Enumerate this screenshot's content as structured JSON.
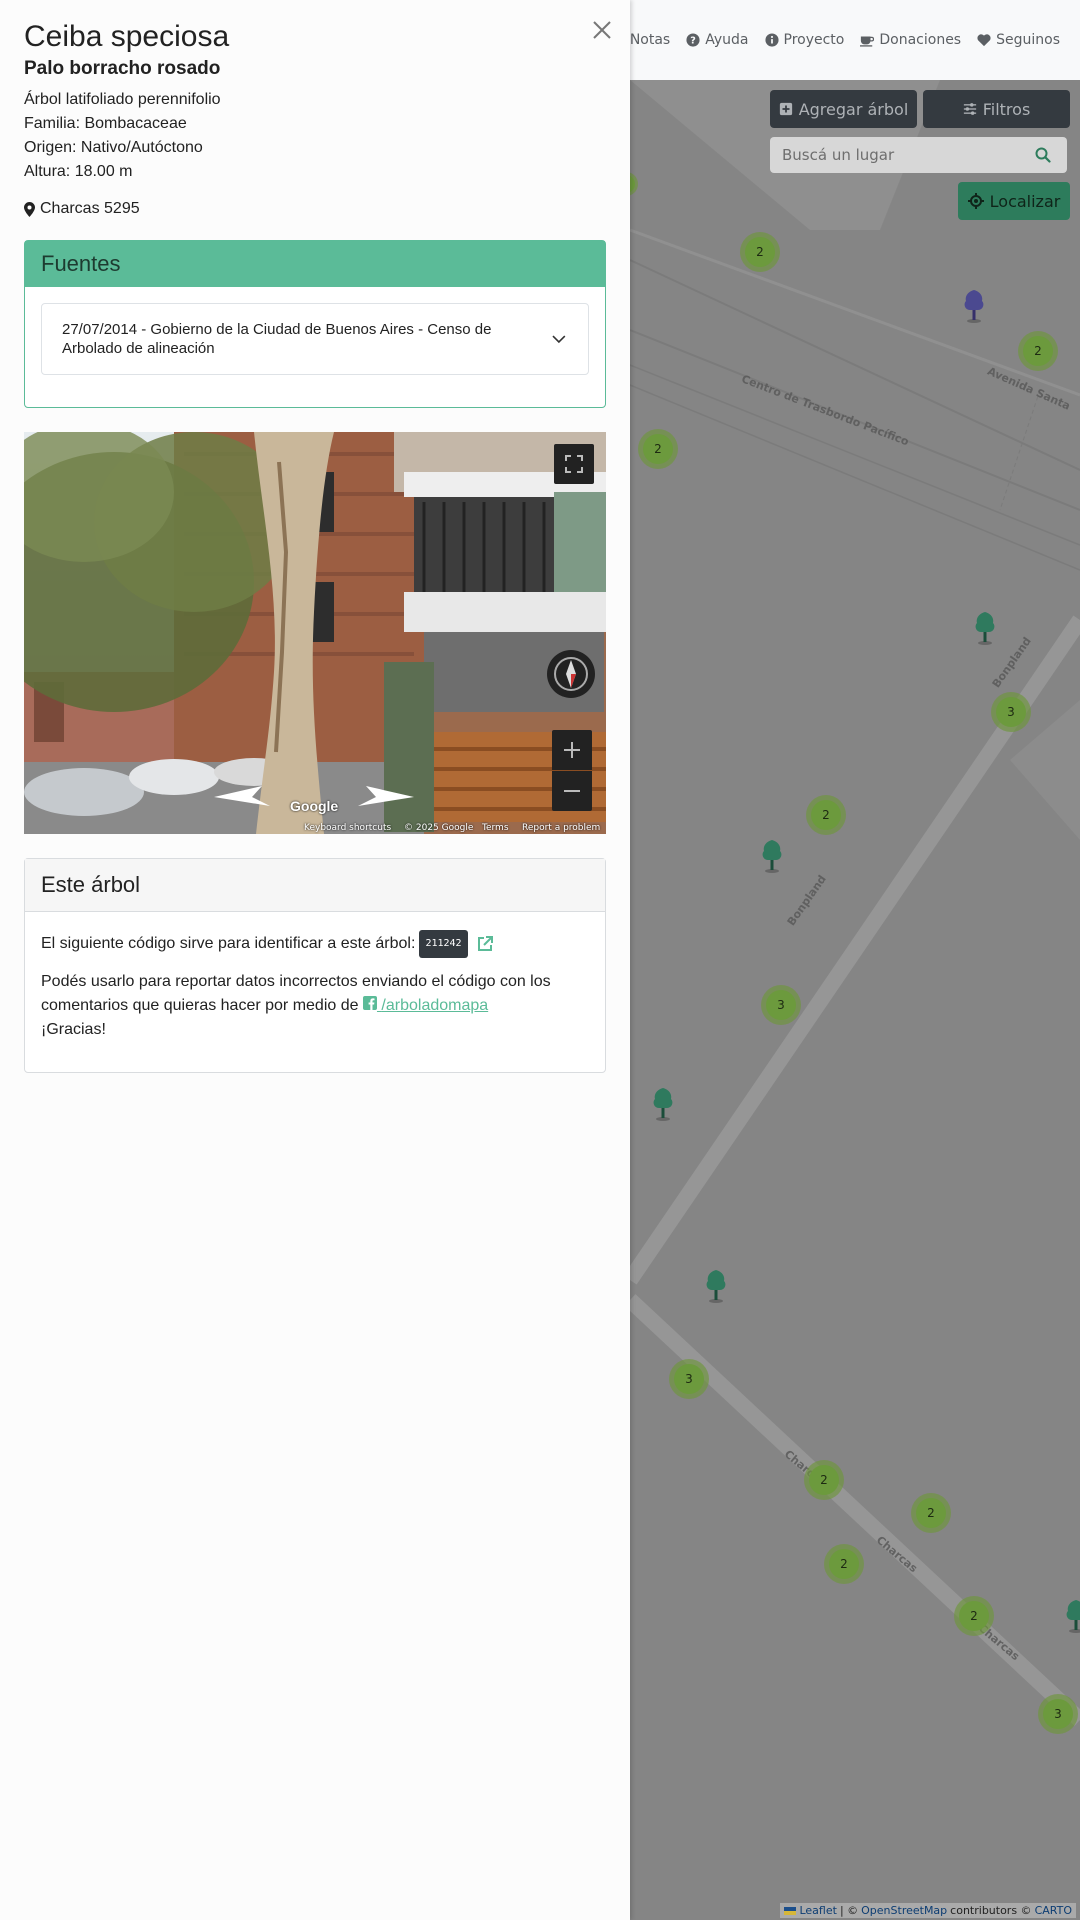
{
  "nav": {
    "items": [
      {
        "label": "Notas",
        "icon": "file-pen-icon"
      },
      {
        "label": "Ayuda",
        "icon": "question-circle-icon"
      },
      {
        "label": "Proyecto",
        "icon": "info-circle-icon"
      },
      {
        "label": "Donaciones",
        "icon": "coffee-cup-icon"
      },
      {
        "label": "Seguinos",
        "icon": "heart-icon"
      }
    ]
  },
  "map": {
    "add_tree_label": "Agregar árbol",
    "filters_label": "Filtros",
    "search_placeholder": "Buscá un lugar",
    "locate_label": "Localizar",
    "streets": [
      "Centro de Trasbordo Pacífico",
      "Avenida Santa",
      "Bonpland",
      "Bonpland",
      "Charcas",
      "Charcas",
      "Charcas"
    ],
    "cluster_counts": [
      "2",
      "2",
      "2",
      "3",
      "2",
      "3",
      "3",
      "2",
      "2",
      "2",
      "2",
      "3"
    ],
    "attribution": {
      "leaflet": "Leaflet",
      "sep1": "| ©",
      "osm": "OpenStreetMap",
      "contrib": "contributors ©",
      "carto": "CARTO"
    },
    "accent_color": "#2d7c5c"
  },
  "panel": {
    "species": "Ceiba speciosa",
    "common_name": "Palo borracho rosado",
    "info": [
      "Árbol latifoliado perennifolio",
      "Familia: Bombacaceae",
      "Origen: Nativo/Autóctono",
      "Altura: 18.00 m"
    ],
    "address": "Charcas 5295",
    "fuentes": {
      "title": "Fuentes",
      "source": "27/07/2014 - Gobierno de la Ciudad de Buenos Aires - Censo de Arbolado de alineación"
    },
    "streetview": {
      "google": "Google",
      "keyboard": "Keyboard shortcuts",
      "copyright": "© 2025 Google",
      "terms": "Terms",
      "report": "Report a problem"
    },
    "este_arbol": {
      "title": "Este árbol",
      "code_text": "El siguiente código sirve para identificar a este árbol:",
      "code": "211242",
      "report_text": "Podés usarlo para reportar datos incorrectos enviando el código con los comentarios que quieras hacer por medio de",
      "fb_link": "/arboladomapa",
      "thanks": "¡Gracias!"
    },
    "accent_color": "#5bbb98"
  }
}
